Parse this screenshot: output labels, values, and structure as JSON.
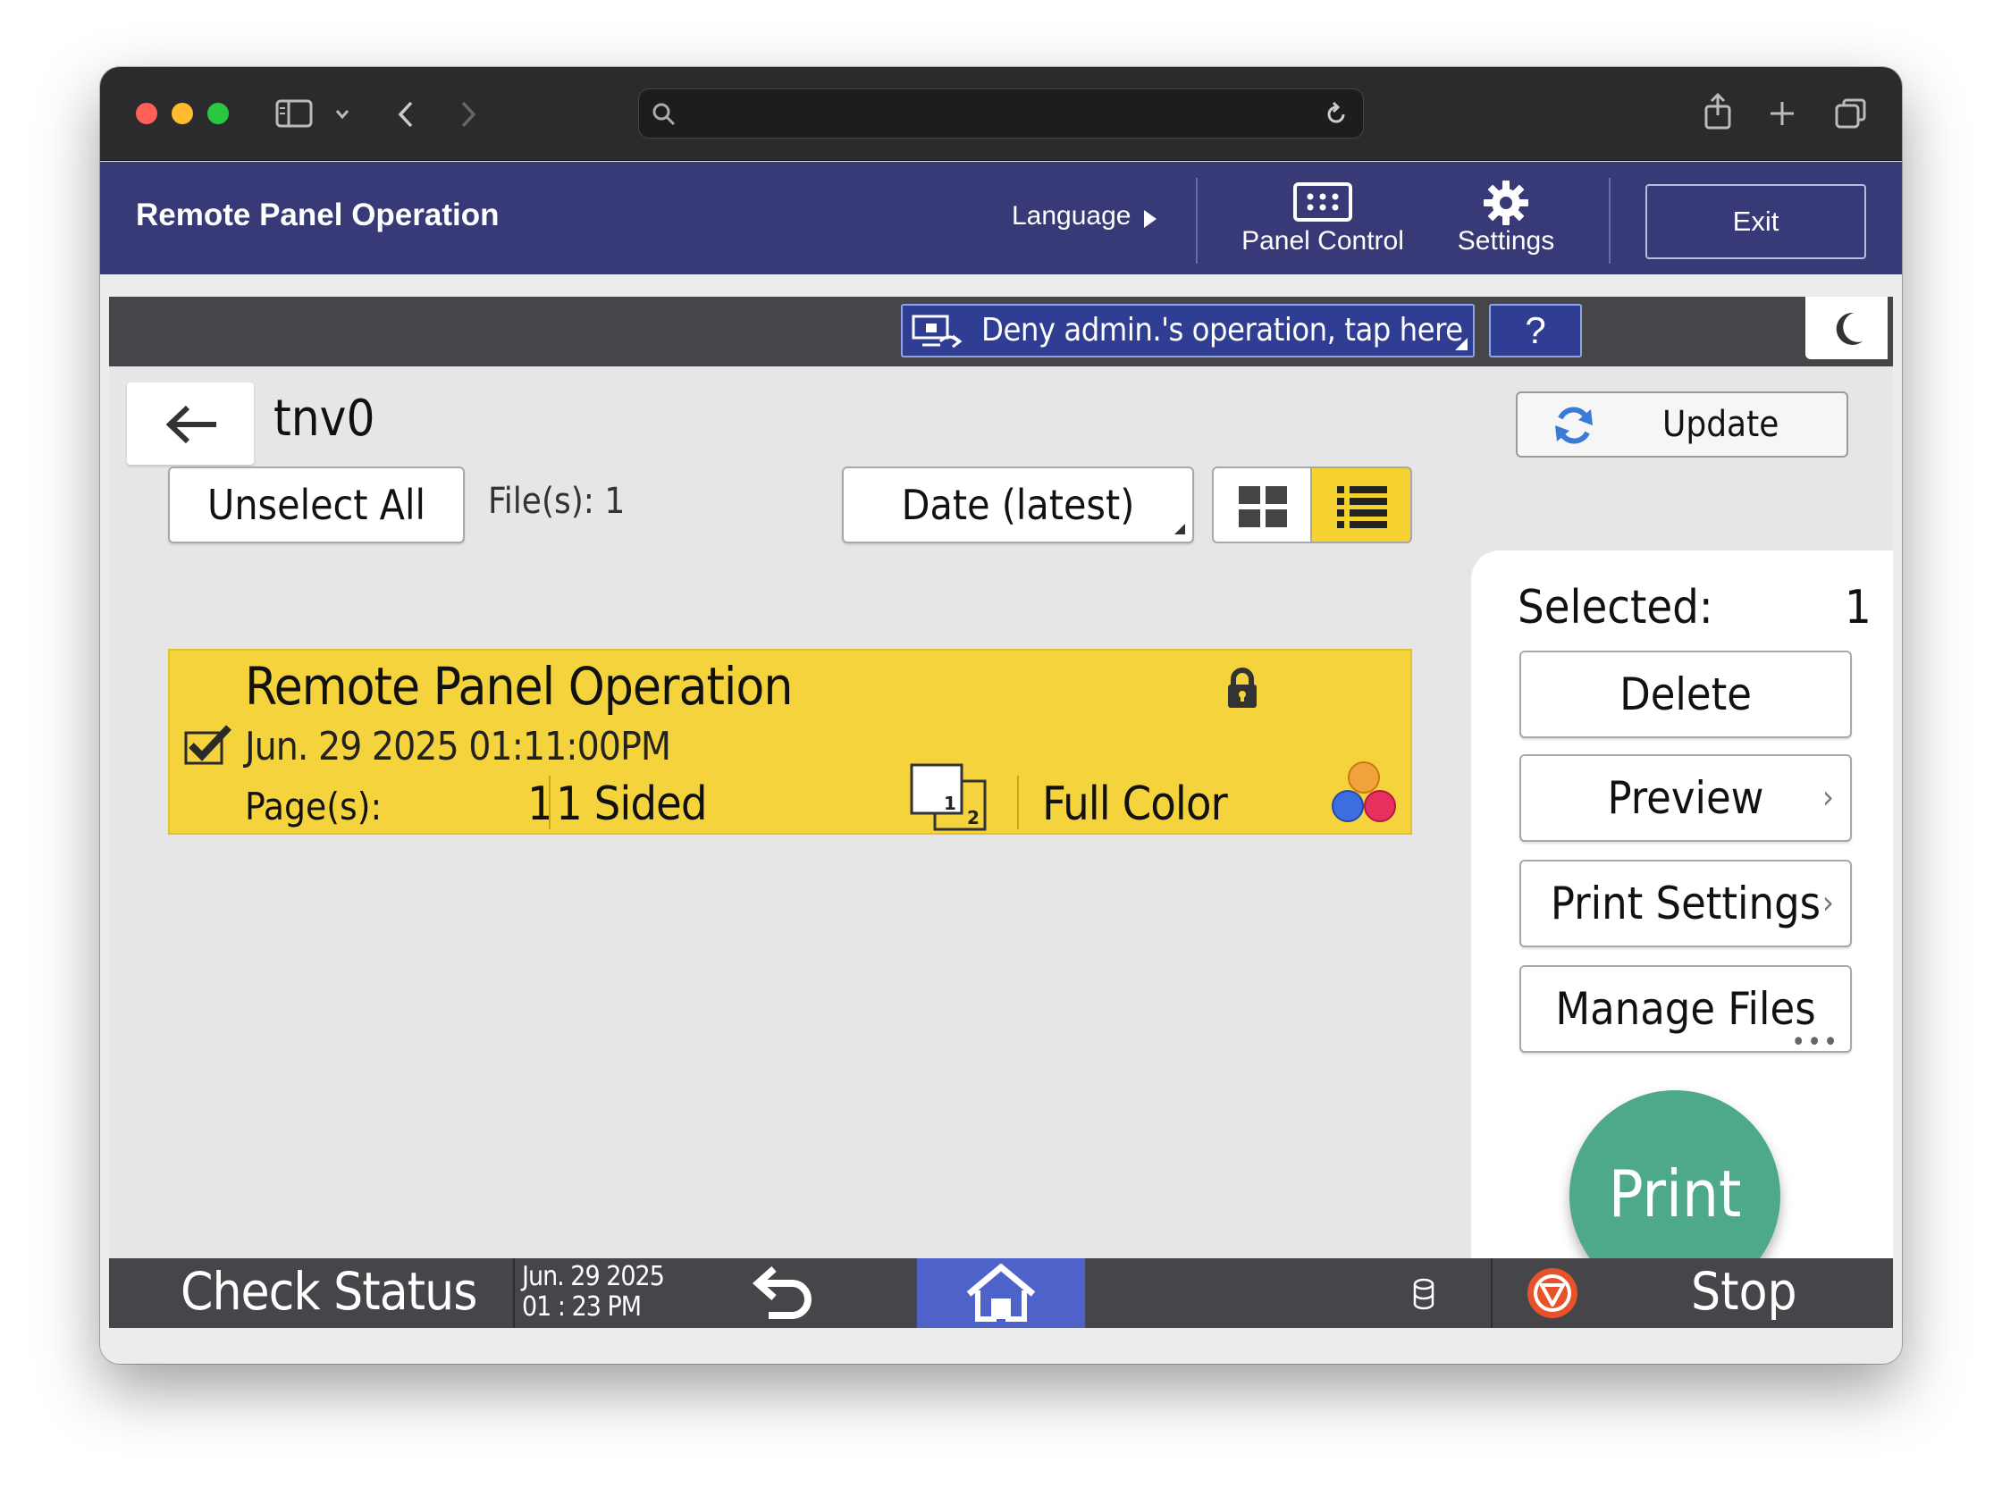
{
  "app": {
    "title": "Remote Panel Operation",
    "language_label": "Language",
    "panel_control_label": "Panel Control",
    "settings_label": "Settings",
    "exit_label": "Exit"
  },
  "topbar": {
    "deny_label": "Deny admin.'s operation, tap here",
    "help_label": "?"
  },
  "folder": {
    "title": "tnv0",
    "update_label": "Update",
    "unselect_all_label": "Unselect All",
    "file_count": "File(s): 1",
    "sort_label": "Date (latest)"
  },
  "files": [
    {
      "name": "Remote Panel Operation",
      "date": "Jun. 29 2025 01:11:00PM",
      "pages_label": "Page(s):",
      "pages": "1",
      "sides": "1 Sided",
      "color_mode": "Full Color",
      "selected": true,
      "locked": true
    }
  ],
  "side": {
    "selected_label": "Selected:",
    "selected_count": "1",
    "delete_label": "Delete",
    "preview_label": "Preview",
    "print_settings_label": "Print Settings",
    "manage_files_label": "Manage Files",
    "print_label": "Print"
  },
  "bottombar": {
    "check_status_label": "Check Status",
    "date_line1": "Jun. 29 2025",
    "date_line2": "01 : 23 PM",
    "stop_label": "Stop"
  },
  "colors": {
    "header_bg": "#373a76",
    "accent_yellow": "#f5d33d",
    "print_green": "#4ea989",
    "home_blue": "#4d63c9",
    "deny_blue": "#2f3e93"
  }
}
